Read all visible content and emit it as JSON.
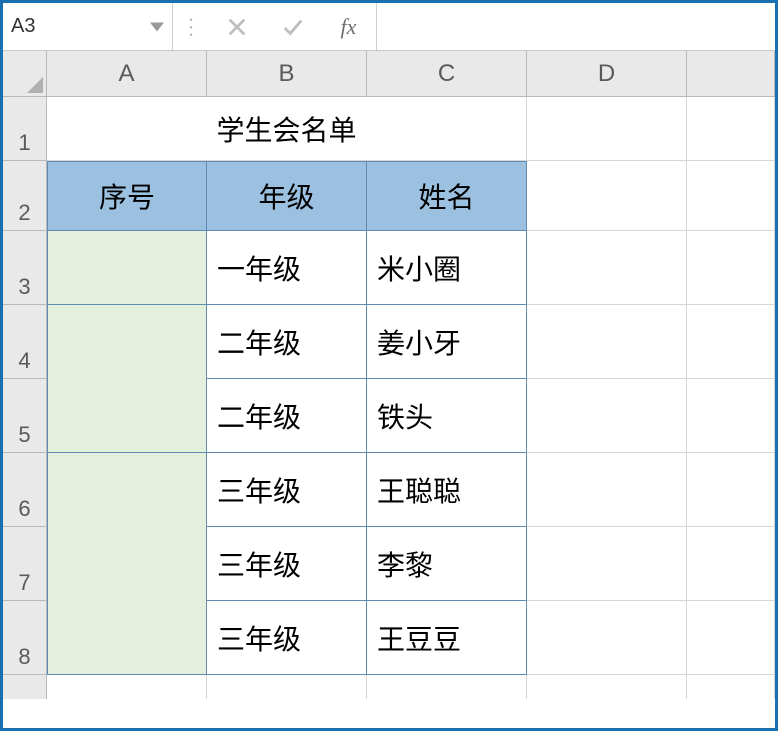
{
  "formula_bar": {
    "name_box": "A3",
    "fx_label": "fx",
    "formula_value": ""
  },
  "columns": [
    "A",
    "B",
    "C",
    "D"
  ],
  "row_numbers": [
    "1",
    "2",
    "3",
    "4",
    "5",
    "6",
    "7",
    "8"
  ],
  "sheet": {
    "title": "学生会名单",
    "headers": {
      "seq": "序号",
      "grade": "年级",
      "name": "姓名"
    },
    "rows": [
      {
        "seq": "",
        "grade": "一年级",
        "name": "米小圈"
      },
      {
        "seq": "",
        "grade": "二年级",
        "name": "姜小牙"
      },
      {
        "seq": "",
        "grade": "二年级",
        "name": "铁头"
      },
      {
        "seq": "",
        "grade": "三年级",
        "name": "王聪聪"
      },
      {
        "seq": "",
        "grade": "三年级",
        "name": "李黎"
      },
      {
        "seq": "",
        "grade": "三年级",
        "name": "王豆豆"
      }
    ]
  }
}
